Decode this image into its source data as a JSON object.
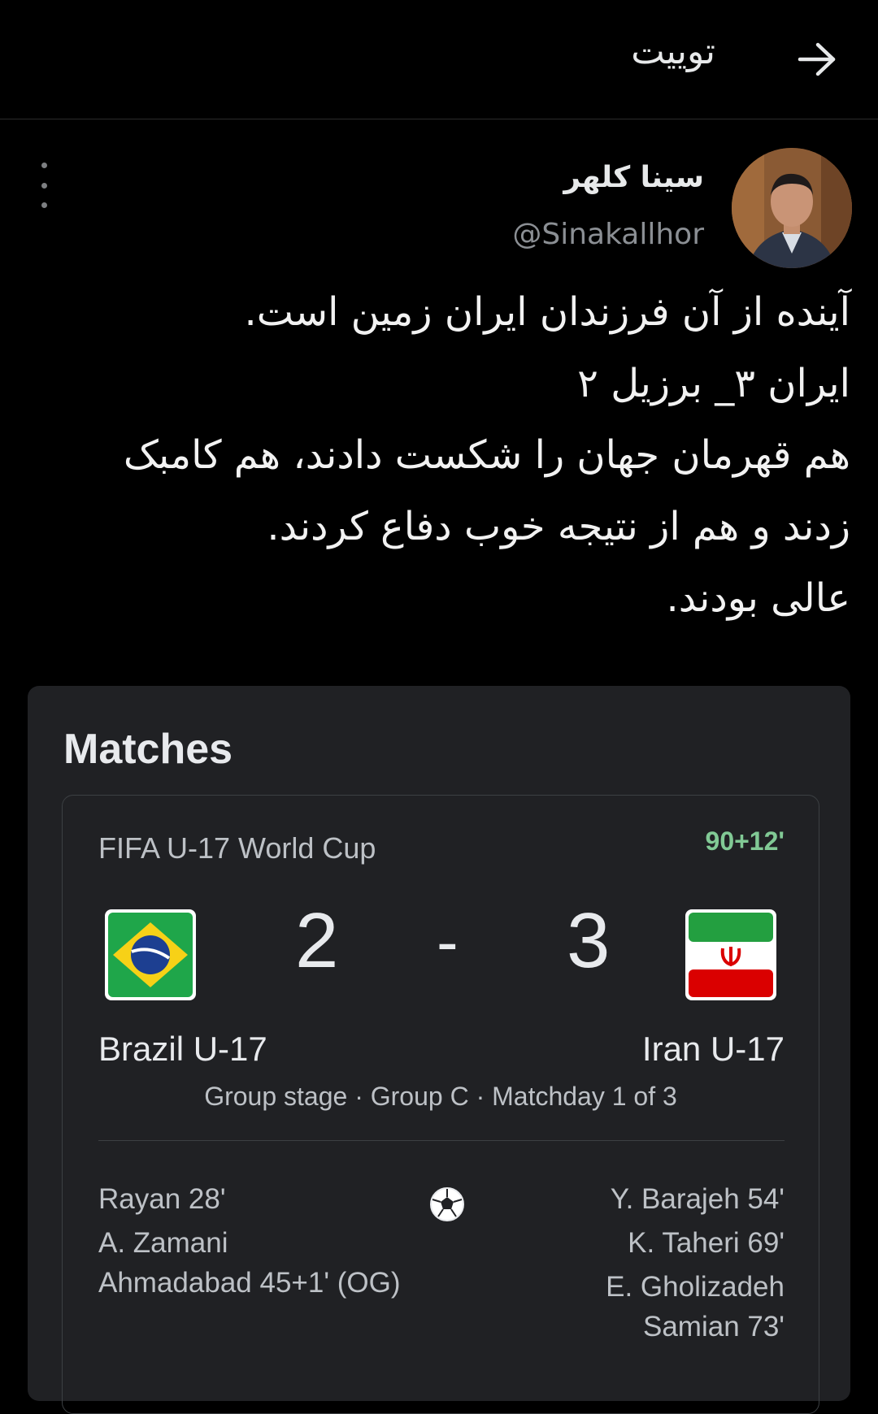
{
  "header": {
    "title": "توییت"
  },
  "tweet": {
    "display_name": "سینا کلهر",
    "handle": "@Sinakallhor",
    "text_lines": [
      "آینده از آن فرزندان ایران زمین است.",
      "ایران ۳_ برزیل ۲",
      "هم قهرمان جهان را شکست دادند، هم کامبک",
      "زدند و هم از نتیجه خوب دفاع کردند.",
      "عالی بودند."
    ]
  },
  "card": {
    "title": "Matches",
    "competition": "FIFA U-17 World Cup",
    "status": "90+12'",
    "home": {
      "team": "Brazil U-17",
      "score": "2",
      "scorers": [
        "Rayan 28'",
        "A. Zamani",
        "Ahmadabad 45+1' (OG)"
      ]
    },
    "separator": "-",
    "away": {
      "team": "Iran U-17",
      "score": "3",
      "scorers": [
        "Y. Barajeh 54'",
        "K. Taheri 69'",
        "E. Gholizadeh",
        "Samian 73'"
      ]
    },
    "stage": "Group stage · Group C · Matchday 1 of 3"
  },
  "icons": {
    "back": "arrow-right-icon",
    "more": "more-vertical-icon",
    "goal": "soccer-ball-icon",
    "brazil_flag": "brazil-flag-icon",
    "iran_flag": "iran-flag-icon"
  },
  "colors": {
    "background": "#000000",
    "card": "#202124",
    "live_status": "#81c995"
  }
}
